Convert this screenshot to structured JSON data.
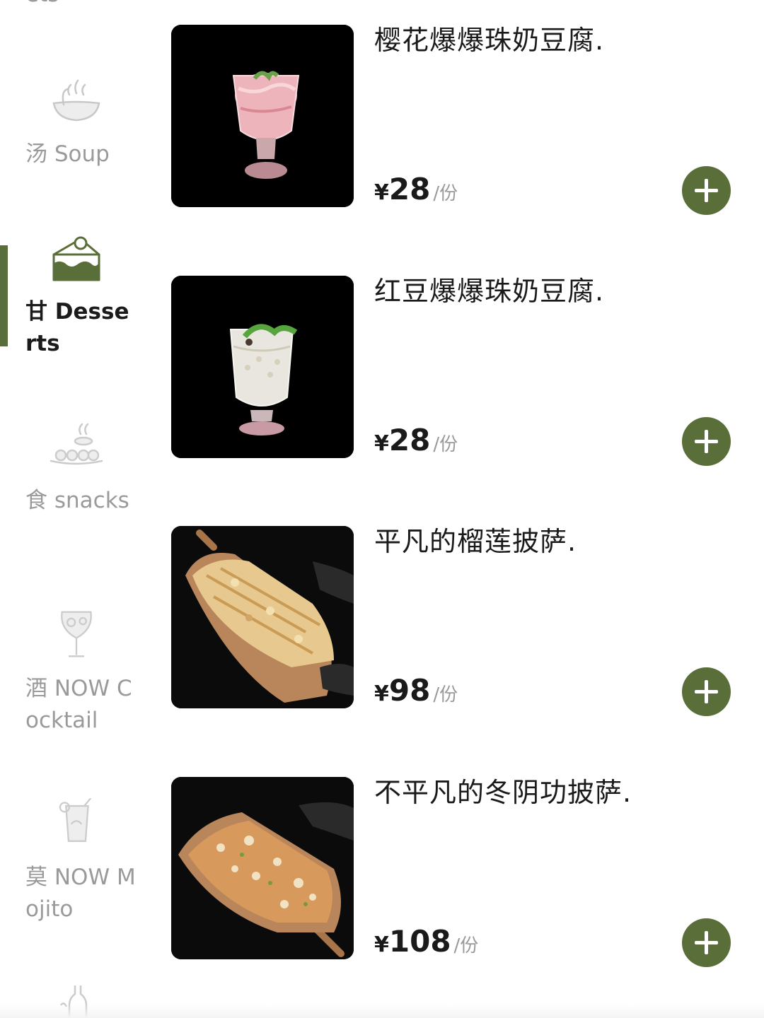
{
  "sidebar": {
    "partial_top_label": "ets",
    "categories": [
      {
        "label": "汤 Soup",
        "icon": "soup-bowl-icon"
      },
      {
        "label": "甘 Desserts",
        "icon": "cake-slice-icon",
        "active": true
      },
      {
        "label": "食 snacks",
        "icon": "snack-dish-icon"
      },
      {
        "label": "酒 NOW Cocktail",
        "icon": "wine-glass-icon"
      },
      {
        "label": "莫 NOW Mojito",
        "icon": "mojito-glass-icon"
      }
    ],
    "bottom_partial_icon": "bottle-icon"
  },
  "products": [
    {
      "name": "樱花爆爆珠奶豆腐.",
      "currency": "¥",
      "price": "28",
      "unit": "/份",
      "image": "pink-dessert-cup"
    },
    {
      "name": "红豆爆爆珠奶豆腐.",
      "currency": "¥",
      "price": "28",
      "unit": "/份",
      "image": "white-dessert-cup"
    },
    {
      "name": "平凡的榴莲披萨.",
      "currency": "¥",
      "price": "98",
      "unit": "/份",
      "image": "durian-pizza-board"
    },
    {
      "name": "不平凡的冬阴功披萨.",
      "currency": "¥",
      "price": "108",
      "unit": "/份",
      "image": "tomyum-pizza-board"
    }
  ],
  "colors": {
    "accent": "#5a6e39",
    "inactive_text": "#9a9a9a",
    "active_text": "#1b1b1b",
    "thumb_bg": "#000000"
  }
}
